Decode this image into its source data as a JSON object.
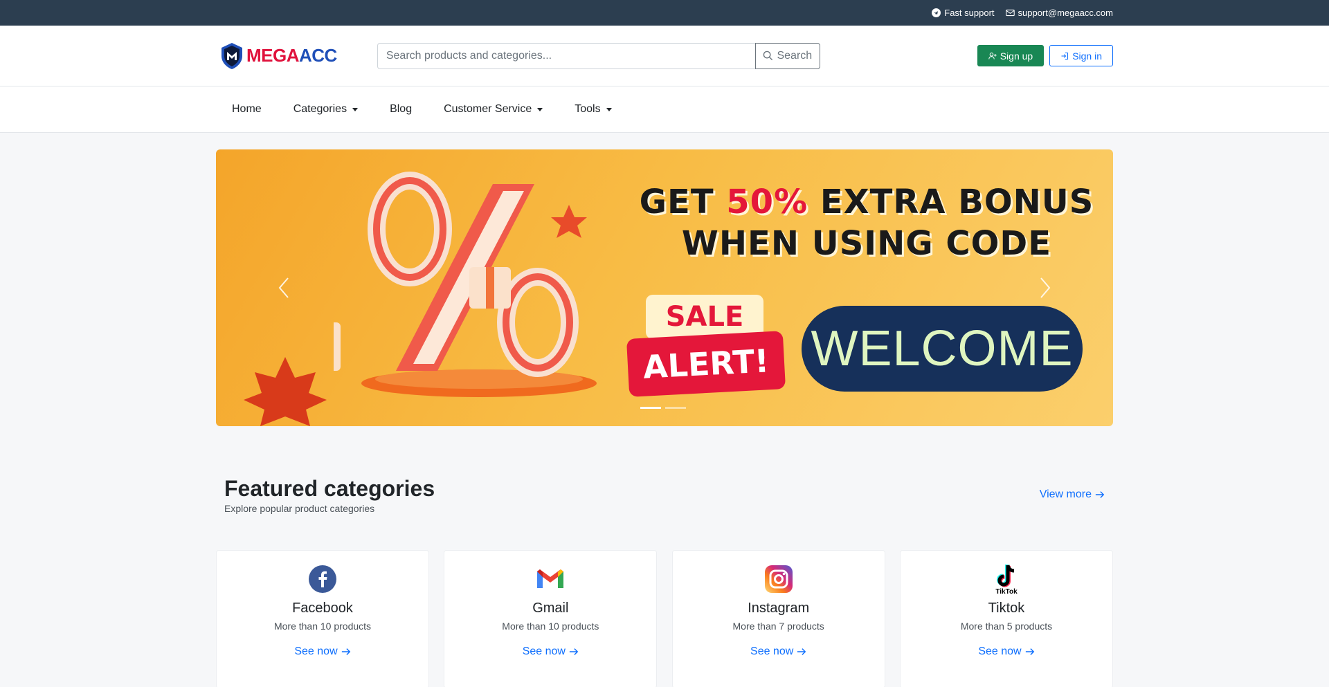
{
  "topbar": {
    "support_label": "Fast support",
    "email": "support@megaacc.com"
  },
  "header": {
    "logo_mega": "MEGA",
    "logo_acc": "ACC",
    "search_placeholder": "Search products and categories...",
    "search_button": "Search",
    "signup_label": "Sign up",
    "signin_label": "Sign in"
  },
  "nav": {
    "items": [
      {
        "label": "Home",
        "dropdown": false
      },
      {
        "label": "Categories",
        "dropdown": true
      },
      {
        "label": "Blog",
        "dropdown": false
      },
      {
        "label": "Customer Service",
        "dropdown": true
      },
      {
        "label": "Tools",
        "dropdown": true
      }
    ]
  },
  "hero": {
    "line1_a": "GET ",
    "line1_hot": "50%",
    "line1_b": " EXTRA BONUS",
    "line2": "WHEN USING CODE",
    "sale_1": "SALE",
    "sale_2": "ALERT!",
    "code": "WELCOME",
    "slides": 2,
    "active_slide": 1,
    "colors": {
      "accent": "#e4173a",
      "pill": "#16305a",
      "code_text": "#dff5c0"
    }
  },
  "featured": {
    "title": "Featured categories",
    "subtitle": "Explore popular product categories",
    "view_more": "View more",
    "cards": [
      {
        "icon": "facebook-icon",
        "name": "Facebook",
        "count": "More than 10 products",
        "cta": "See now"
      },
      {
        "icon": "gmail-icon",
        "name": "Gmail",
        "count": "More than 10 products",
        "cta": "See now"
      },
      {
        "icon": "instagram-icon",
        "name": "Instagram",
        "count": "More than 7 products",
        "cta": "See now"
      },
      {
        "icon": "tiktok-icon",
        "name": "Tiktok",
        "count": "More than 5 products",
        "cta": "See now"
      }
    ]
  }
}
